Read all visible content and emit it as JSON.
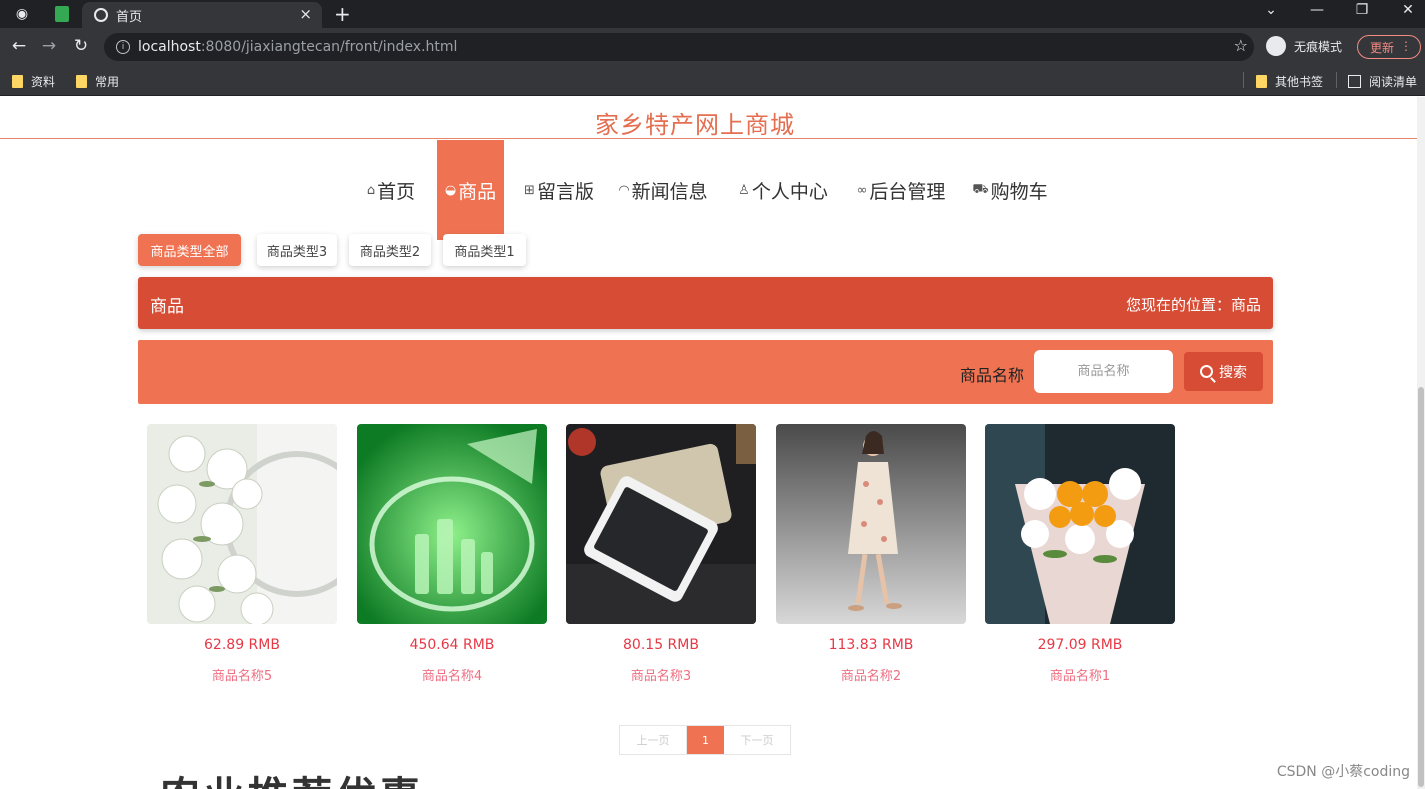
{
  "browser": {
    "tab_title": "首页",
    "tab_close": "×",
    "new_tab": "+",
    "url_host": "localhost",
    "url_rest": ":8080/jiaxiangtecan/front/index.html",
    "incognito_label": "无痕模式",
    "update_label": "更新",
    "bookmarks": [
      "资料",
      "常用"
    ],
    "other_bookmarks": "其他书签",
    "reading_list": "阅读清单",
    "controls": {
      "minimize": "—",
      "restore": "❐",
      "close": "✕",
      "chevron": "⌄"
    }
  },
  "site": {
    "title": "家乡特产网上商城",
    "nav": [
      {
        "label": "首页",
        "icon": "⌂"
      },
      {
        "label": "商品",
        "icon": "◒"
      },
      {
        "label": "留言版",
        "icon": "⊞"
      },
      {
        "label": "新闻信息",
        "icon": "◠"
      },
      {
        "label": "个人中心",
        "icon": "♙"
      },
      {
        "label": "后台管理",
        "icon": "∞"
      },
      {
        "label": "购物车",
        "icon": "⛟"
      }
    ],
    "categories": [
      "商品类型全部",
      "商品类型3",
      "商品类型2",
      "商品类型1"
    ],
    "section_title": "商品",
    "location_text": "您现在的位置：商品",
    "search": {
      "label": "商品名称",
      "placeholder": "商品名称",
      "button": "搜索"
    },
    "products": [
      {
        "price": "62.89 RMB",
        "name": "商品名称5"
      },
      {
        "price": "450.64 RMB",
        "name": "商品名称4"
      },
      {
        "price": "80.15 RMB",
        "name": "商品名称3"
      },
      {
        "price": "113.83 RMB",
        "name": "商品名称2"
      },
      {
        "price": "297.09 RMB",
        "name": "商品名称1"
      }
    ],
    "pager": {
      "prev": "上一页",
      "current": "1",
      "next": "下一页"
    },
    "bottom_heading": "农业推荐优惠"
  },
  "watermark": "CSDN @小蔡coding"
}
